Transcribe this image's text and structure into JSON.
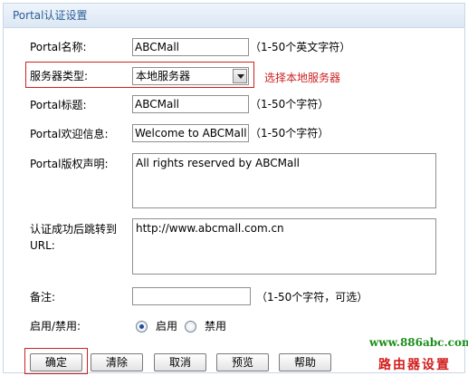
{
  "header": {
    "title": "Portal认证设置"
  },
  "form": {
    "name": {
      "label": "Portal名称:",
      "value": "ABCMall",
      "hint": "（1-50个英文字符）"
    },
    "server_type": {
      "label": "服务器类型:",
      "selected": "本地服务器",
      "note": "选择本地服务器"
    },
    "title": {
      "label": "Portal标题:",
      "value": "ABCMall",
      "hint": "（1-50个字符）"
    },
    "welcome": {
      "label": "Portal欢迎信息:",
      "value": "Welcome to ABCMall",
      "hint": "（1-50个字符）"
    },
    "copyright": {
      "label": "Portal版权声明:",
      "value": "All rights reserved by ABCMall"
    },
    "redirect": {
      "label_line1": "认证成功后跳转到",
      "label_line2": "URL:",
      "value": "http://www.abcmall.com.cn"
    },
    "remark": {
      "label": "备注:",
      "value": "",
      "hint": "（1-50个字符，可选）"
    },
    "enable": {
      "label": "启用/禁用:",
      "on_label": "启用",
      "off_label": "禁用",
      "selected": "on"
    }
  },
  "buttons": {
    "confirm": "确定",
    "clear": "清除",
    "cancel": "取消",
    "preview": "预览",
    "help": "帮助"
  },
  "watermark": {
    "site": "www.886abc.com",
    "text": "路由器设置"
  },
  "colors": {
    "highlight": "#cc2222",
    "header_text": "#2b5d96",
    "watermark_site": "#1b8f1b",
    "watermark_text": "#d21d1d"
  }
}
